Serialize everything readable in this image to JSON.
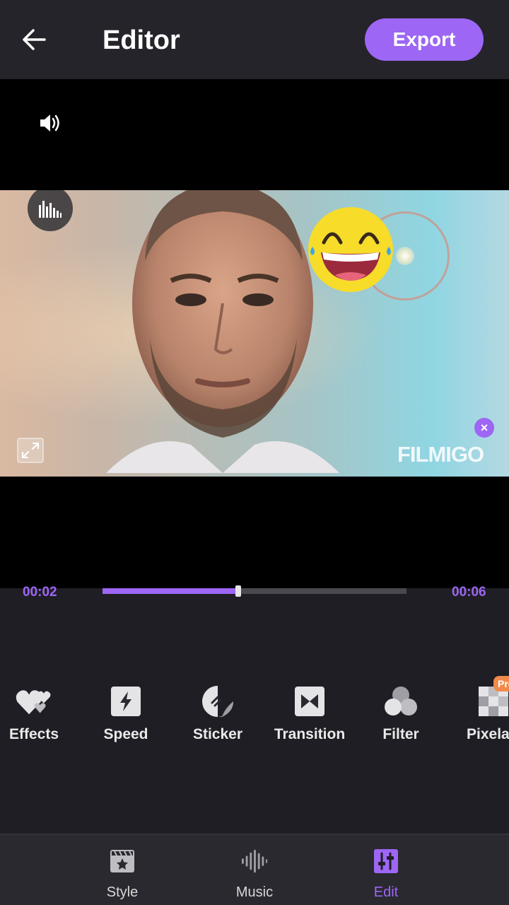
{
  "header": {
    "title": "Editor",
    "export_label": "Export"
  },
  "preview": {
    "watermark": "FILMIGO",
    "remove_watermark_glyph": "×"
  },
  "timeline": {
    "current_time": "00:02",
    "total_time": "00:06",
    "progress_fraction": 0.447
  },
  "tools": [
    {
      "label": "Effects",
      "icon": "hearts-icon"
    },
    {
      "label": "Speed",
      "icon": "lightning-icon"
    },
    {
      "label": "Sticker",
      "icon": "sticker-icon"
    },
    {
      "label": "Transition",
      "icon": "transition-icon"
    },
    {
      "label": "Filter",
      "icon": "filter-circles-icon"
    },
    {
      "label": "Pixelate",
      "icon": "pixelate-icon",
      "badge": "Pro"
    }
  ],
  "nav": [
    {
      "label": "Style",
      "icon": "clapperboard-star-icon"
    },
    {
      "label": "Music",
      "icon": "waveform-icon"
    },
    {
      "label": "Edit",
      "icon": "sliders-icon",
      "active": true
    }
  ],
  "colors": {
    "accent": "#9d66f5",
    "background": "#1f1e24",
    "header": "#25242b",
    "pro_badge": "#f08a4b"
  }
}
